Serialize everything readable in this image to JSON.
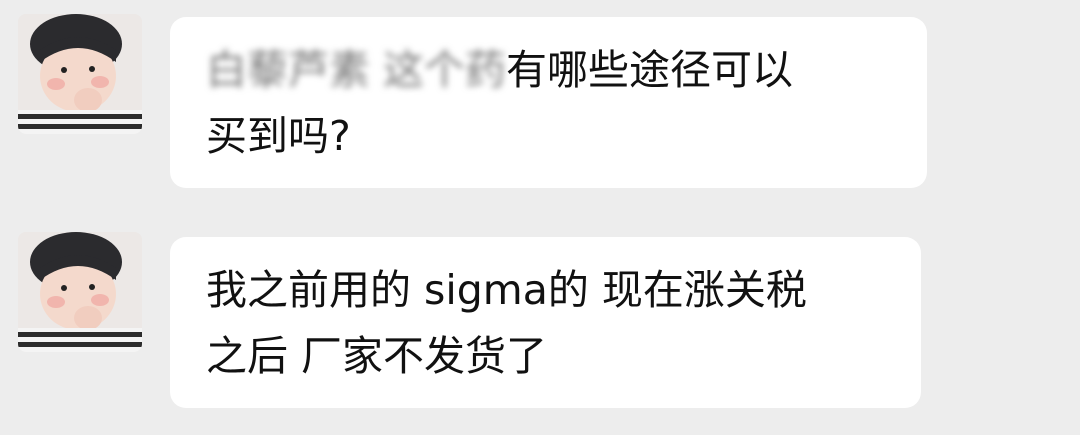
{
  "chat": {
    "messages": [
      {
        "sender": "other",
        "avatar_icon": "toddler-photo-avatar",
        "line1_redacted": "白藜芦素 这个药",
        "line1_visible": "有哪些途径可以",
        "line2": "买到吗?"
      },
      {
        "sender": "other",
        "avatar_icon": "toddler-photo-avatar",
        "line1": "我之前用的 sigma的 现在涨关税",
        "line2": "之后 厂家不发货了"
      }
    ]
  },
  "colors": {
    "background": "#ededed",
    "bubble": "#ffffff",
    "text": "#111111"
  }
}
